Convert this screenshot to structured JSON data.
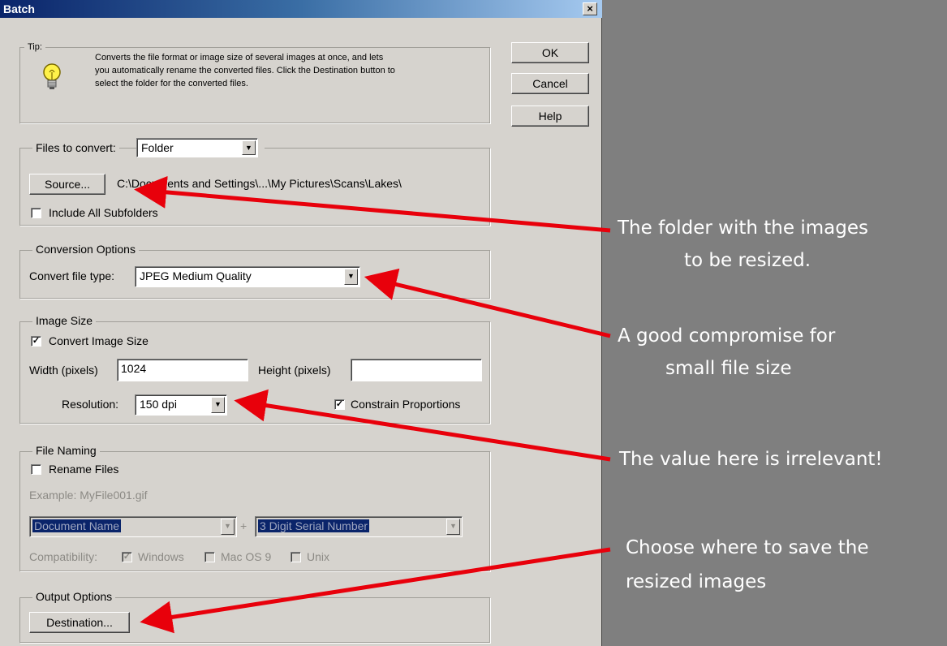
{
  "window": {
    "title": "Batch",
    "close_label": "×"
  },
  "buttons": {
    "ok": "OK",
    "cancel": "Cancel",
    "help": "Help"
  },
  "tip": {
    "legend": "Tip:",
    "line1": "Converts the file format or image size of several images at once, and lets",
    "line2": "you automatically rename the converted files. Click the Destination button to",
    "line3": "select the folder for the converted files."
  },
  "files": {
    "label": "Files to convert:",
    "select_value": "Folder",
    "source_button": "Source...",
    "source_path": "C:\\Documents and Settings\\...\\My Pictures\\Scans\\Lakes\\",
    "include_subfolders": "Include All Subfolders",
    "include_subfolders_checked": false
  },
  "conversion": {
    "legend": "Conversion Options",
    "label": "Convert file type:",
    "value": "JPEG Medium Quality"
  },
  "image_size": {
    "legend": "Image Size",
    "convert_label": "Convert Image Size",
    "convert_checked": true,
    "width_label": "Width (pixels)",
    "width_value": "1024",
    "height_label": "Height (pixels)",
    "height_value": "",
    "resolution_label": "Resolution:",
    "resolution_value": "150 dpi",
    "constrain_label": "Constrain Proportions",
    "constrain_checked": true
  },
  "naming": {
    "legend": "File Naming",
    "rename_label": "Rename Files",
    "rename_checked": false,
    "example": "Example: MyFile001.gif",
    "name_value": "Document Name",
    "plus": "+",
    "serial_value": "3 Digit Serial Number",
    "compat_label": "Compatibility:",
    "windows": "Windows",
    "windows_checked": true,
    "mac": "Mac OS 9",
    "mac_checked": false,
    "unix": "Unix",
    "unix_checked": false
  },
  "output": {
    "legend": "Output Options",
    "destination_button": "Destination..."
  },
  "annotations": {
    "folder_line1": "The folder with the images",
    "folder_line2": "to be resized.",
    "compromise_line1": "A good compromise for",
    "compromise_line2": "small file size",
    "irrelevant": "The value here is irrelevant!",
    "choose_line1": "Choose where to save the",
    "choose_line2": "resized images"
  },
  "colors": {
    "arrow": "#e8000b",
    "dialog_bg": "#d6d3ce",
    "backdrop": "#7f7f7f",
    "titlebar": "#0a246a"
  },
  "icons": {
    "tip": "lightbulb-icon",
    "checkmark": "✓",
    "dropdown": "▼"
  }
}
